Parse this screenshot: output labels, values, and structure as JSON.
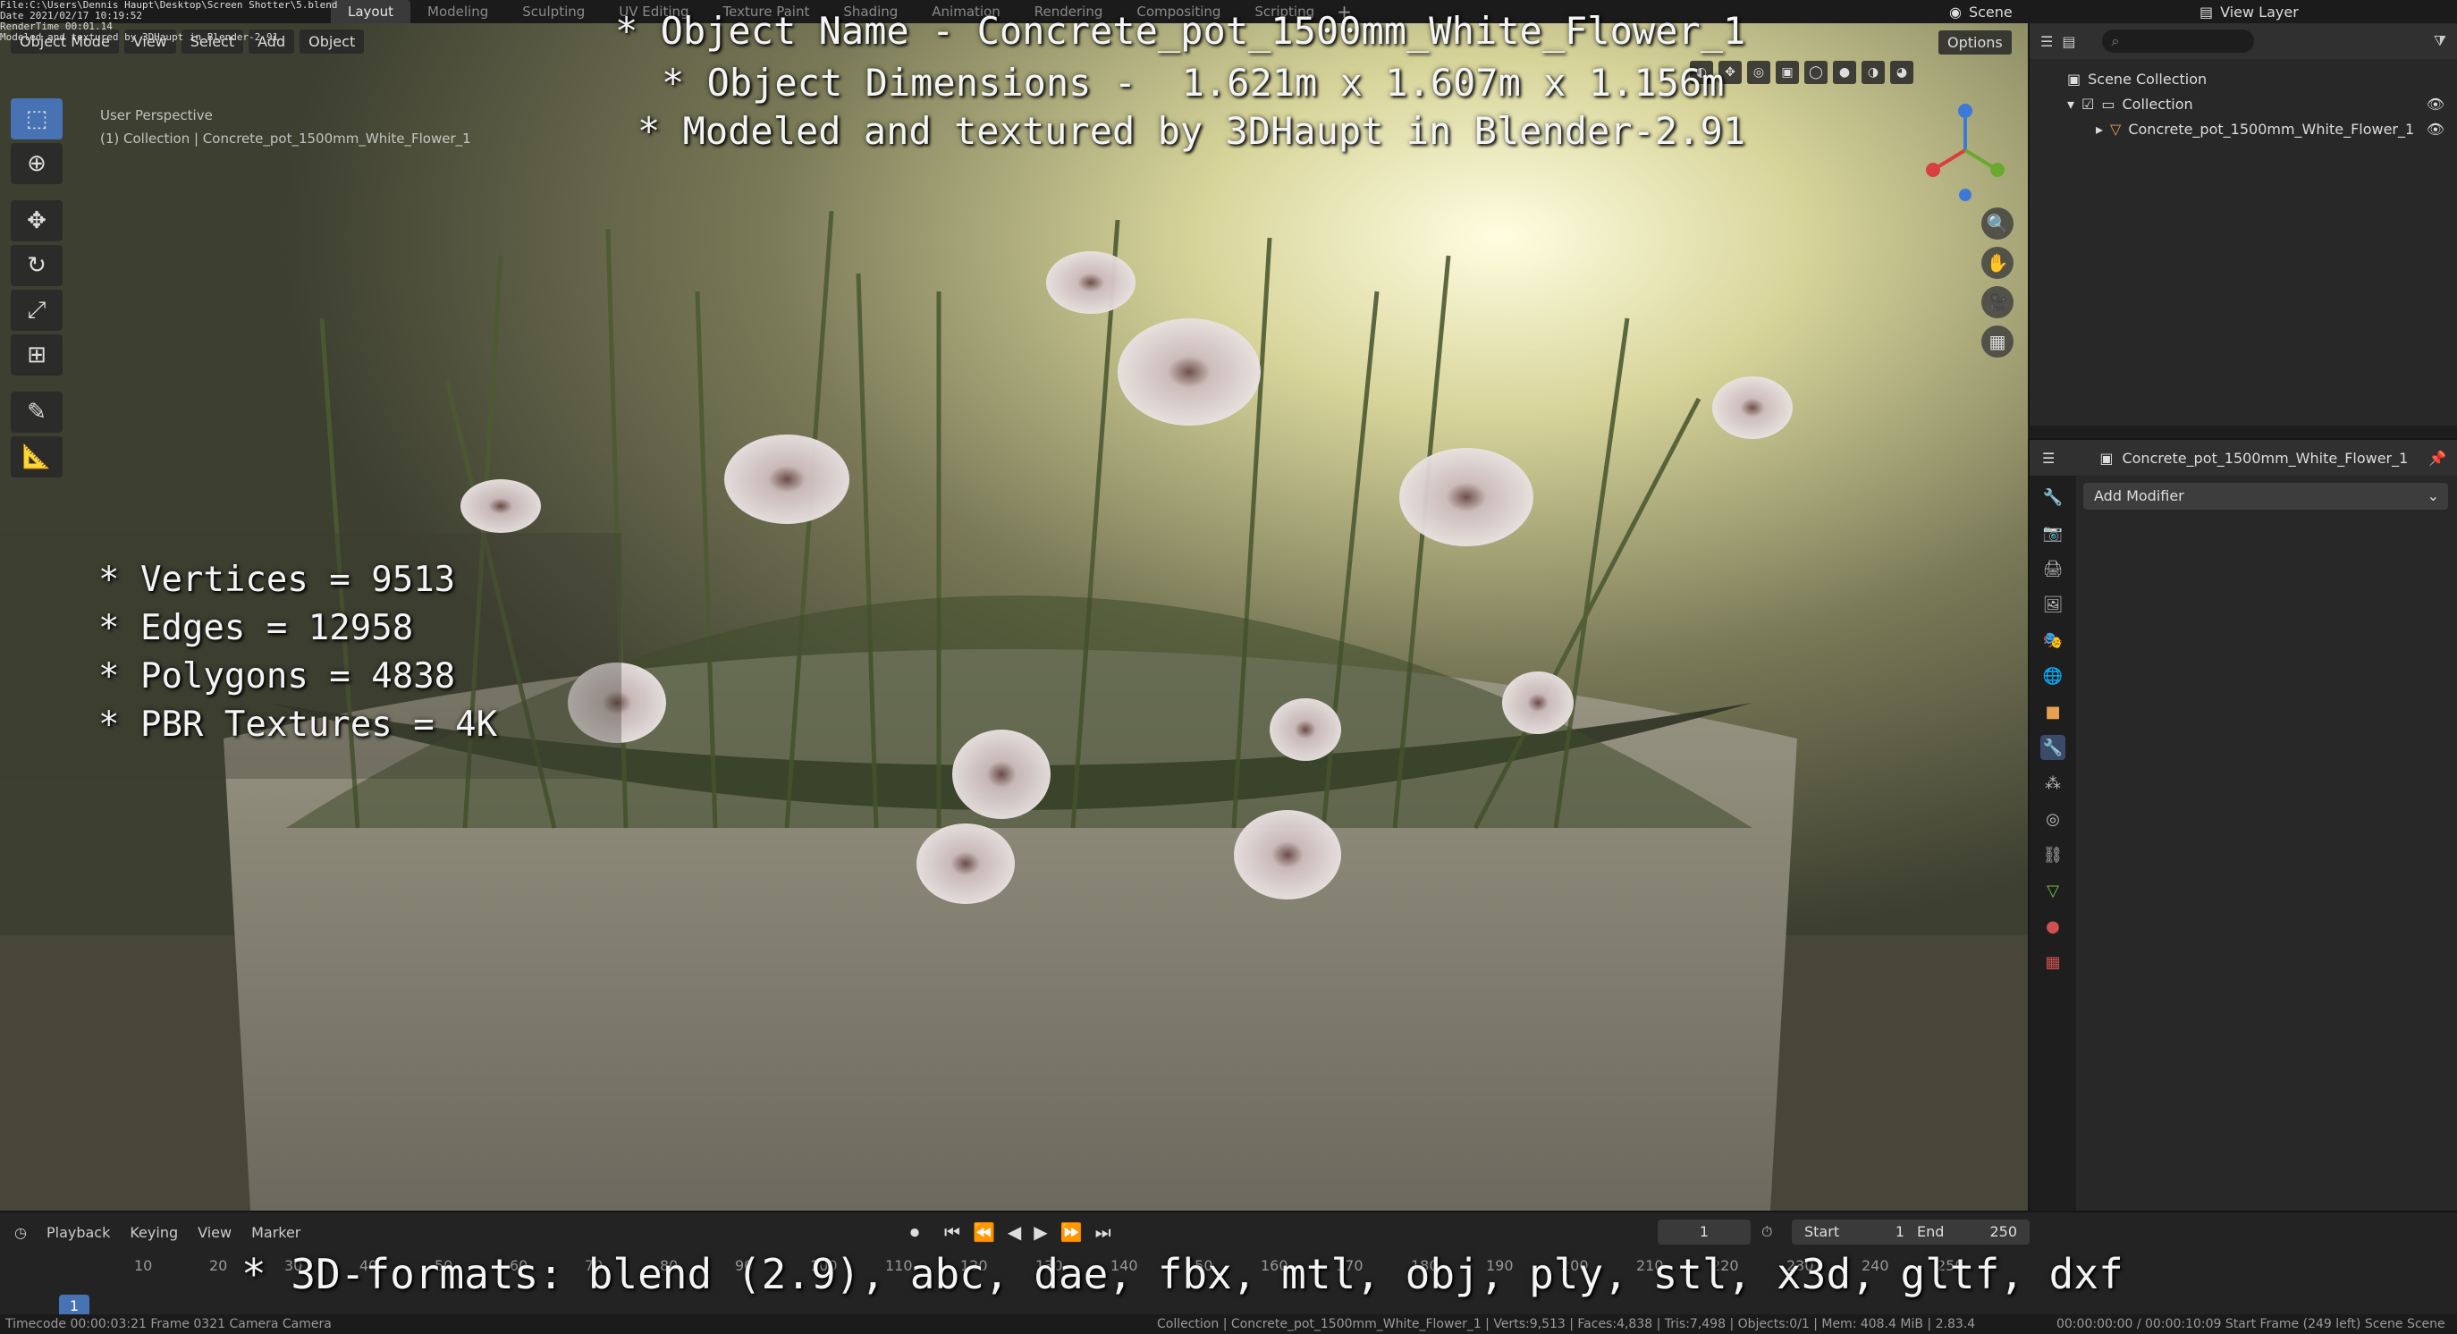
{
  "info_overlay": {
    "lines": [
      "File:C:\\Users\\Dennis Haupt\\Desktop\\Screen Shotter\\5.blend",
      "Date 2021/02/17 10:19:52",
      "RenderTime 00:01.14",
      "Modeled and textured by 3DHaupt in Blender-2.91"
    ]
  },
  "topbar": {
    "workspaces": [
      "Layout",
      "Modeling",
      "Sculpting",
      "UV Editing",
      "Texture Paint",
      "Shading",
      "Animation",
      "Rendering",
      "Compositing",
      "Scripting"
    ],
    "active_workspace": "Layout",
    "add": "+",
    "scene": "Scene",
    "view_layer": "View Layer"
  },
  "viewport": {
    "mode": "Object Mode",
    "menus": [
      "View",
      "Select",
      "Add",
      "Object"
    ],
    "options": "Options",
    "perspective": "User Perspective",
    "collection_path": "(1) Collection | Concrete_pot_1500mm_White_Flower_1"
  },
  "overlay_text": {
    "line1": "* Object Name - Concrete_pot_1500mm_White_Flower_1",
    "line2": "* Object Dimensions -  1.621m x 1.607m x 1.156m",
    "line3": "* Modeled and textured by 3DHaupt in Blender-2.91",
    "stats": [
      "* Vertices = 9513",
      "* Edges = 12958",
      "* Polygons = 4838",
      "* PBR Textures = 4K"
    ],
    "formats": "* 3D-formats: blend (2.9), abc, dae, fbx, mtl, obj, ply, stl, x3d, gltf, dxf"
  },
  "outliner": {
    "root": "Scene Collection",
    "collection": "Collection",
    "object": "Concrete_pot_1500mm_White_Flower_1"
  },
  "properties": {
    "object_name": "Concrete_pot_1500mm_White_Flower_1",
    "add_modifier": "Add Modifier"
  },
  "timeline": {
    "menus": [
      "Playback",
      "Keying",
      "View",
      "Marker"
    ],
    "current_frame": "1",
    "start_label": "Start",
    "start": "1",
    "end_label": "End",
    "end": "250",
    "ticks": [
      "1",
      "10",
      "20",
      "30",
      "40",
      "50",
      "60",
      "70",
      "80",
      "90",
      "100",
      "110",
      "120",
      "130",
      "140",
      "150",
      "160",
      "170",
      "180",
      "190",
      "200",
      "210",
      "220",
      "230",
      "240",
      "250"
    ]
  },
  "statusbar": {
    "left": "Timecode 00:00:03:21   Frame 0321   Camera Camera",
    "center": "Collection | Concrete_pot_1500mm_White_Flower_1 | Verts:9,513 | Faces:4,838 | Tris:7,498 | Objects:0/1 | Mem: 408.4 MiB | 2.83.4",
    "right": "00:00:00:00 / 00:00:10:09     Start Frame (249 left)   Scene Scene"
  },
  "colors": {
    "accent": "#4772b3",
    "panel": "#282828",
    "header": "#303030"
  }
}
